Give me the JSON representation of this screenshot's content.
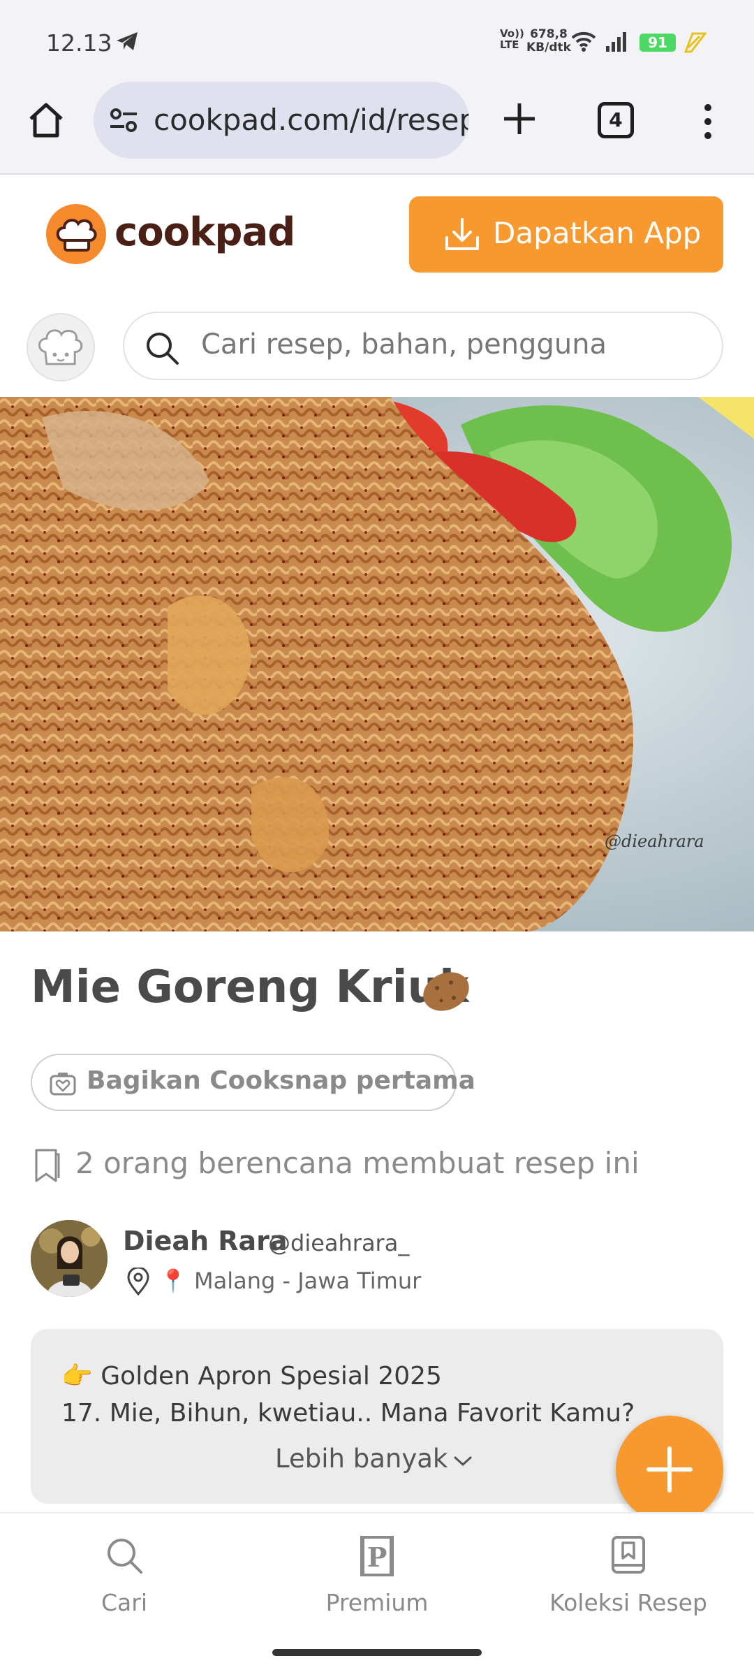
{
  "status_bar": {
    "time": "12.13",
    "network": "Vo)) LTE",
    "speed_line1": "678,8",
    "speed_line2": "KB/dtk",
    "battery": "91"
  },
  "browser": {
    "url": "cookpad.com/id/resep",
    "tab_count": "4"
  },
  "header": {
    "logo_text": "cookpad",
    "get_app_label": "Dapatkan App",
    "accent": "#f7992e"
  },
  "search": {
    "placeholder": "Cari resep, bahan, pengguna"
  },
  "hero": {
    "watermark": "@dieahrara"
  },
  "recipe": {
    "title": "Mie Goreng Kriuk",
    "cooksnap_label": "Bagikan Cooksnap pertama",
    "plan_text": "2 orang berencana membuat resep ini"
  },
  "author": {
    "name": "Dieah Rara",
    "handle": "@dieahrara_",
    "location": "📍 Malang - Jawa Timur"
  },
  "story": {
    "line1": "👉 Golden Apron Spesial 2025",
    "line2": "17. Mie, Bihun, kwetiau.. Mana Favorit Kamu?",
    "more_label": "Lebih banyak"
  },
  "bottom_nav": {
    "items": [
      {
        "label": "Cari",
        "icon": "search-icon"
      },
      {
        "label": "Premium",
        "icon": "premium-icon"
      },
      {
        "label": "Koleksi Resep",
        "icon": "collection-icon"
      }
    ]
  }
}
